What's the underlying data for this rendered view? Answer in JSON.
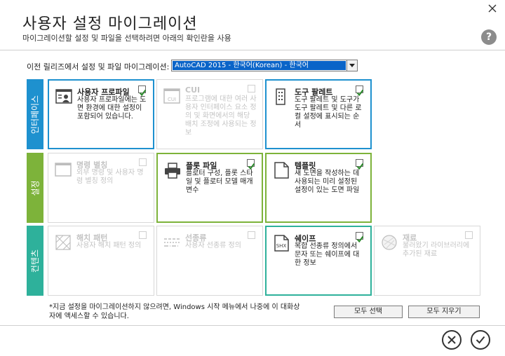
{
  "window": {
    "close_icon": "close-icon"
  },
  "header": {
    "title": "사용자 설정 마이그레이션",
    "subtitle": "마이그레이션할 설정 및 파일을 선택하려면 아래의 확인란을 사용",
    "help_label": "?"
  },
  "migrate": {
    "label": "이전 릴리즈에서 설정 및 파일 마이그레이션:",
    "selected": "AutoCAD 2015 - 한국어(Korean) - 한국어"
  },
  "rows": [
    {
      "label": "인터페이스",
      "color": "#1e91cf"
    },
    {
      "label": "설정",
      "color": "#7db33a"
    },
    {
      "label": "컨텐츠",
      "color": "#2eb19b"
    }
  ],
  "cards": {
    "user_profile": {
      "title": "사용자 프로파일",
      "desc": "사용자 프로파일에는 도면 환경에 대한 설정이 포함되어 있습니다.",
      "checked": true,
      "icon": "user-profile-icon"
    },
    "cui": {
      "title": "CUI",
      "desc": "프로그램에 대한 여러 사용자 인터페이스 요소 정의 및 화면에서의 해당 배치 조정에 사용되는 정보",
      "checked": false,
      "icon": "cui-icon"
    },
    "tool_palette": {
      "title": "도구 팔레트",
      "desc": "도구 팔레트 및 도구가 도구 팔레트 및 다른 로컬 설정에 표시되는 순서",
      "checked": true,
      "icon": "tool-palette-icon"
    },
    "command_alias": {
      "title": "명령 별칭",
      "desc": "외부 명령 및 사용자 명령 별칭 정의",
      "checked": false,
      "icon": "command-alias-icon"
    },
    "plot": {
      "title": "플롯 파일",
      "desc": "플로터 구성, 플롯 스타일 및 플로터 모델 매개변수",
      "checked": true,
      "icon": "plotter-icon"
    },
    "template": {
      "title": "템플릿",
      "desc": "새 도면을 작성하는 데 사용되는 미리 설정된 설정이 있는 도면 파일",
      "checked": true,
      "icon": "template-icon"
    },
    "hatch": {
      "title": "해치 패턴",
      "desc": "사용자 해치 패턴 정의",
      "checked": false,
      "icon": "hatch-pattern-icon"
    },
    "linetype": {
      "title": "선종류",
      "desc": "사용자 선종류 정의",
      "checked": false,
      "icon": "linetype-icon"
    },
    "shape": {
      "title": "쉐이프",
      "desc": "복합 선종류 정의에서 문자 또는 쉐이프에 대한 정보",
      "checked": true,
      "icon": "shx-icon",
      "icon_text": "SHX"
    },
    "material": {
      "title": "재료",
      "desc": "불러왔기 라이브러리에 추가된 재료",
      "checked": false,
      "icon": "material-icon"
    }
  },
  "footnote": "*지금 설정을 마이그레이션하지 않으려면, Windows 시작 메뉴에서 나중에 이 대화상자에 액세스할 수 있습니다.",
  "buttons": {
    "select_all": "모두 선택",
    "clear_all": "모두 지우기"
  },
  "actions": {
    "cancel_icon": "cancel-icon",
    "ok_icon": "ok-icon"
  }
}
